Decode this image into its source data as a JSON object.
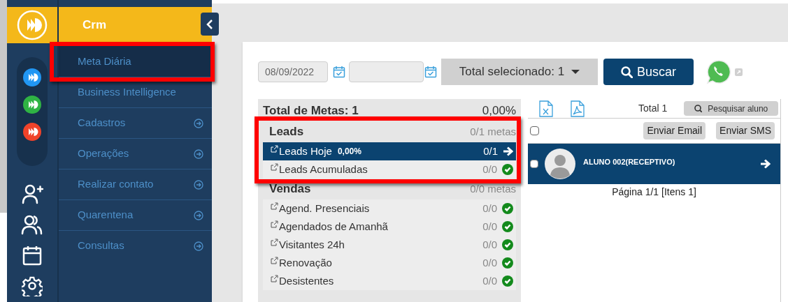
{
  "rail": {
    "apps": [
      {
        "color": "#2196f3"
      },
      {
        "color": "#2fb344"
      },
      {
        "color": "#f0432a"
      }
    ]
  },
  "menu": {
    "title": "Crm",
    "items": [
      {
        "label": "Meta Diária",
        "kind": "link",
        "selected": true,
        "highlighted": true
      },
      {
        "label": "Business Intelligence",
        "kind": "link",
        "selected": false,
        "highlighted": false
      },
      {
        "label": "Cadastros",
        "kind": "submenu",
        "selected": false,
        "highlighted": false
      },
      {
        "label": "Operações",
        "kind": "submenu",
        "selected": false,
        "highlighted": false
      },
      {
        "label": "Realizar contato",
        "kind": "submenu",
        "selected": false,
        "highlighted": false
      },
      {
        "label": "Quarentena",
        "kind": "submenu",
        "selected": false,
        "highlighted": false
      },
      {
        "label": "Consultas",
        "kind": "submenu",
        "selected": false,
        "highlighted": false
      }
    ]
  },
  "filters": {
    "date_from": "08/09/2022",
    "select": "Total selecionado: 1",
    "search_button": "Buscar"
  },
  "goals": {
    "title": "Total de Metas: 1",
    "percent": "0,00%",
    "groups": [
      {
        "name": "Leads",
        "count": "0/1 metas",
        "highlighted": true,
        "items": [
          {
            "label": "Leads Hoje",
            "percent": "0,00%",
            "count": "0/1",
            "selected": true,
            "done": false
          },
          {
            "label": "Leads Acumuladas",
            "count": "0/0",
            "selected": false,
            "done": true
          }
        ]
      },
      {
        "name": "Vendas",
        "count": "0/0 metas",
        "highlighted": false,
        "items": [
          {
            "label": "Agend. Presenciais",
            "count": "0/0",
            "selected": false,
            "done": true
          },
          {
            "label": "Agendados de Amanhã",
            "count": "0/0",
            "selected": false,
            "done": true
          },
          {
            "label": "Visitantes 24h",
            "count": "0/0",
            "selected": false,
            "done": true
          },
          {
            "label": "Renovação",
            "count": "0/0",
            "selected": false,
            "done": true
          },
          {
            "label": "Desistentes",
            "count": "0/0",
            "selected": false,
            "done": true
          }
        ]
      }
    ]
  },
  "results": {
    "total": "Total 1",
    "search": "Pesquisar aluno",
    "all_checked": false,
    "actions": [
      "Enviar Email",
      "Enviar SMS"
    ],
    "students": [
      {
        "name": "ALUNO 002(RECEPTIVO)",
        "selected": true,
        "checked": false
      }
    ],
    "pagination": "Página 1/1 [Itens 1]"
  }
}
